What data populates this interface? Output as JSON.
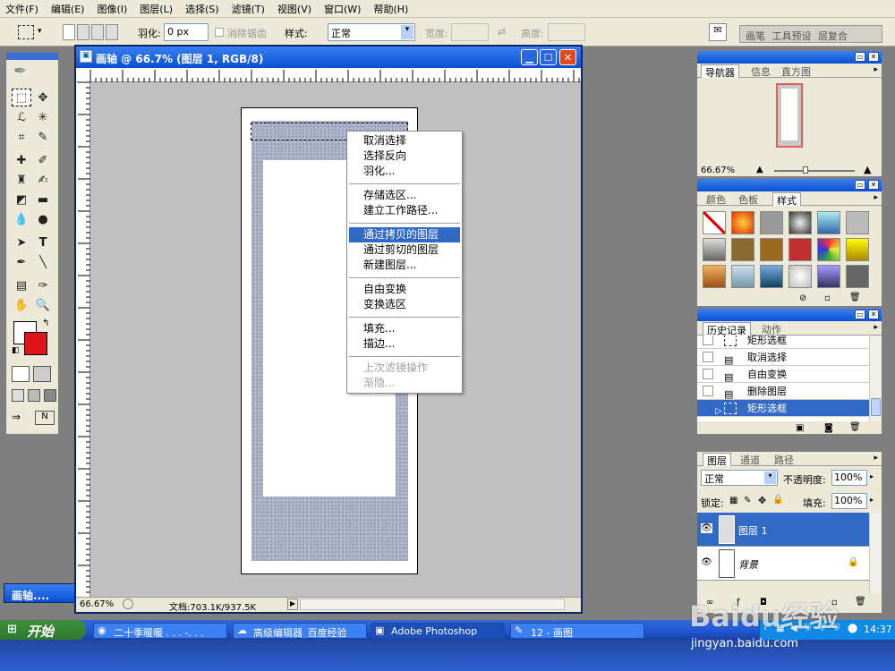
{
  "menubar": [
    "文件(F)",
    "编辑(E)",
    "图像(I)",
    "图层(L)",
    "选择(S)",
    "滤镜(T)",
    "视图(V)",
    "窗口(W)",
    "帮助(H)"
  ],
  "options": {
    "feather_label": "羽化:",
    "feather_value": "0 px",
    "antialias_label": "消除锯齿",
    "style_label": "样式:",
    "style_value": "正常",
    "width_label": "宽度:",
    "height_label": "高度:",
    "palette_tabs": [
      "画笔",
      "工具预设",
      "层复合"
    ]
  },
  "document": {
    "title": "画轴 @ 66.7% (图层 1, RGB/8)",
    "zoom": "66.67%",
    "doc_size": "文档:703.1K/937.5K"
  },
  "context_menu": {
    "items": [
      {
        "label": "取消选择",
        "state": "normal"
      },
      {
        "label": "选择反向",
        "state": "normal"
      },
      {
        "label": "羽化...",
        "state": "normal"
      },
      {
        "label": "存储选区...",
        "state": "normal"
      },
      {
        "label": "建立工作路径...",
        "state": "normal"
      },
      {
        "label": "通过拷贝的图层",
        "state": "highlighted"
      },
      {
        "label": "通过剪切的图层",
        "state": "normal"
      },
      {
        "label": "新建图层...",
        "state": "normal"
      },
      {
        "label": "自由变换",
        "state": "normal"
      },
      {
        "label": "变换选区",
        "state": "normal"
      },
      {
        "label": "填充...",
        "state": "normal"
      },
      {
        "label": "描边...",
        "state": "normal"
      },
      {
        "label": "上次滤镜操作",
        "state": "disabled"
      },
      {
        "label": "渐隐...",
        "state": "disabled"
      }
    ]
  },
  "navigator": {
    "tabs": [
      "导航器",
      "信息",
      "直方图"
    ],
    "zoom": "66.67%"
  },
  "swatches": {
    "tabs": [
      "颜色",
      "色板",
      "样式"
    ]
  },
  "history": {
    "tabs": [
      "历史记录",
      "动作"
    ],
    "items": [
      "矩形选框",
      "取消选择",
      "自由变换",
      "删除图层",
      "矩形选框"
    ]
  },
  "layers": {
    "tabs": [
      "图层",
      "通道",
      "路径"
    ],
    "blend_mode": "正常",
    "opacity_label": "不透明度:",
    "opacity_value": "100%",
    "lock_label": "锁定:",
    "fill_label": "填充:",
    "fill_value": "100%",
    "items": [
      {
        "name": "图层 1",
        "selected": true
      },
      {
        "name": "背景",
        "selected": false
      }
    ]
  },
  "minimized_doc": "画轴....",
  "taskbar": {
    "start": "开始",
    "items": [
      "二十季暖暖 . . . -. . .",
      "高级编辑器_百度经验",
      "Adobe Photoshop",
      "12 - 画图"
    ],
    "clock": "14:37"
  },
  "watermark": {
    "logo": "Baidu经验",
    "url": "jingyan.baidu.com"
  },
  "colors": {
    "foreground": "#ffffff",
    "background": "#e0141c",
    "highlight": "#316ac5",
    "titlebar": "#0a4fd3"
  }
}
